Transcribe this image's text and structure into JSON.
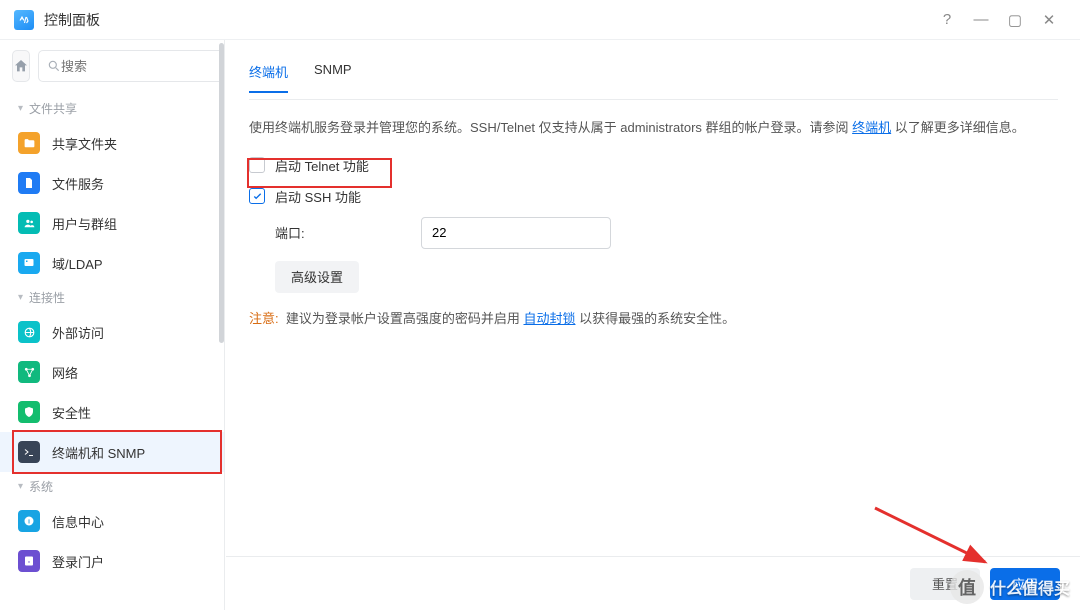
{
  "window": {
    "title": "控制面板"
  },
  "search": {
    "placeholder": "搜索"
  },
  "sections": {
    "s1": "文件共享",
    "s2": "连接性",
    "s3": "系统"
  },
  "nav": {
    "shared_folder": "共享文件夹",
    "file_services": "文件服务",
    "users_groups": "用户与群组",
    "domain_ldap": "域/LDAP",
    "external_access": "外部访问",
    "network": "网络",
    "security": "安全性",
    "terminal_snmp": "终端机和 SNMP",
    "info_center": "信息中心",
    "login_portal": "登录门户"
  },
  "tabs": {
    "terminal": "终端机",
    "snmp": "SNMP"
  },
  "desc": {
    "prefix": "使用终端机服务登录并管理您的系统。SSH/Telnet 仅支持从属于 administrators 群组的帐户登录。请参阅 ",
    "link": "终端机",
    "suffix": " 以了解更多详细信息。"
  },
  "checks": {
    "telnet": "启动 Telnet 功能",
    "ssh": "启动 SSH 功能"
  },
  "form": {
    "port_label": "端口:",
    "port_value": "22",
    "advanced": "高级设置"
  },
  "notice": {
    "label": "注意:",
    "prefix": "建议为登录帐户设置高强度的密码并启用 ",
    "link": "自动封锁",
    "suffix": " 以获得最强的系统安全性。"
  },
  "footer": {
    "reset": "重置",
    "apply": "应用"
  },
  "watermark": "什么值得买"
}
